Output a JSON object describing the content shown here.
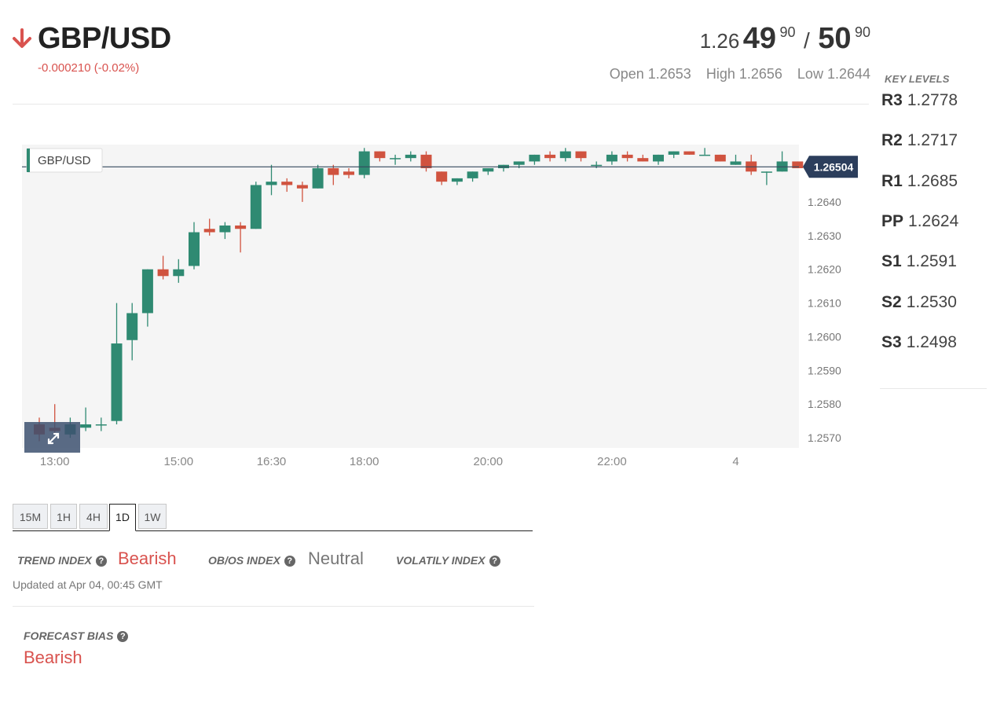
{
  "header": {
    "pair": "GBP/USD",
    "direction_icon": "arrow-down-icon",
    "change": "-0.000210 (-0.02%)",
    "quote": {
      "bid_prefix": "1.26",
      "bid_big": "49",
      "bid_sup": "90",
      "separator": "/",
      "ask_big": "50",
      "ask_sup": "90"
    },
    "open": "Open 1.2653",
    "high": "High 1.2656",
    "low": "Low 1.2644"
  },
  "key_levels": {
    "title": "KEY LEVELS",
    "levels": [
      {
        "name": "R3",
        "value": "1.2778"
      },
      {
        "name": "R2",
        "value": "1.2717"
      },
      {
        "name": "R1",
        "value": "1.2685"
      },
      {
        "name": "PP",
        "value": "1.2624"
      },
      {
        "name": "S1",
        "value": "1.2591"
      },
      {
        "name": "S2",
        "value": "1.2530"
      },
      {
        "name": "S3",
        "value": "1.2498"
      }
    ]
  },
  "chart_data": {
    "type": "candlestick",
    "legend": "GBP/USD",
    "current_price": 1.26504,
    "current_price_label": "1.26504",
    "ylim": [
      1.2567,
      1.2657
    ],
    "y_ticks": [
      "1.2640",
      "1.2630",
      "1.2620",
      "1.2610",
      "1.2600",
      "1.2590",
      "1.2580",
      "1.2570"
    ],
    "y_tick_values": [
      1.264,
      1.263,
      1.262,
      1.261,
      1.26,
      1.259,
      1.258,
      1.257
    ],
    "x_ticks": [
      {
        "label": "13:00",
        "index": 1
      },
      {
        "label": "15:00",
        "index": 9
      },
      {
        "label": "16:30",
        "index": 15
      },
      {
        "label": "18:00",
        "index": 21
      },
      {
        "label": "20:00",
        "index": 29
      },
      {
        "label": "22:00",
        "index": 37
      },
      {
        "label": "4",
        "index": 45
      }
    ],
    "candles": [
      {
        "o": 1.2574,
        "h": 1.2576,
        "l": 1.2569,
        "c": 1.2571
      },
      {
        "o": 1.2573,
        "h": 1.258,
        "l": 1.2571,
        "c": 1.2572
      },
      {
        "o": 1.2571,
        "h": 1.2576,
        "l": 1.257,
        "c": 1.2574
      },
      {
        "o": 1.2573,
        "h": 1.2579,
        "l": 1.2572,
        "c": 1.2574
      },
      {
        "o": 1.2574,
        "h": 1.2576,
        "l": 1.2572,
        "c": 1.2574
      },
      {
        "o": 1.2575,
        "h": 1.261,
        "l": 1.2574,
        "c": 1.2598
      },
      {
        "o": 1.2599,
        "h": 1.261,
        "l": 1.2593,
        "c": 1.2607
      },
      {
        "o": 1.2607,
        "h": 1.262,
        "l": 1.2603,
        "c": 1.262
      },
      {
        "o": 1.262,
        "h": 1.2624,
        "l": 1.2617,
        "c": 1.2618
      },
      {
        "o": 1.2618,
        "h": 1.2623,
        "l": 1.2616,
        "c": 1.262
      },
      {
        "o": 1.2621,
        "h": 1.2634,
        "l": 1.262,
        "c": 1.2631
      },
      {
        "o": 1.2632,
        "h": 1.2635,
        "l": 1.263,
        "c": 1.2631
      },
      {
        "o": 1.2631,
        "h": 1.2634,
        "l": 1.2629,
        "c": 1.2633
      },
      {
        "o": 1.2633,
        "h": 1.2634,
        "l": 1.2625,
        "c": 1.2632
      },
      {
        "o": 1.2632,
        "h": 1.2646,
        "l": 1.2632,
        "c": 1.2645
      },
      {
        "o": 1.2645,
        "h": 1.2651,
        "l": 1.2642,
        "c": 1.2646
      },
      {
        "o": 1.2646,
        "h": 1.2647,
        "l": 1.2643,
        "c": 1.2645
      },
      {
        "o": 1.2645,
        "h": 1.2646,
        "l": 1.264,
        "c": 1.2644
      },
      {
        "o": 1.2644,
        "h": 1.2651,
        "l": 1.2644,
        "c": 1.265
      },
      {
        "o": 1.265,
        "h": 1.2651,
        "l": 1.2645,
        "c": 1.2648
      },
      {
        "o": 1.2649,
        "h": 1.265,
        "l": 1.2647,
        "c": 1.2648
      },
      {
        "o": 1.2648,
        "h": 1.2656,
        "l": 1.2647,
        "c": 1.2655
      },
      {
        "o": 1.2655,
        "h": 1.2655,
        "l": 1.2652,
        "c": 1.2653
      },
      {
        "o": 1.2653,
        "h": 1.2654,
        "l": 1.2651,
        "c": 1.2653
      },
      {
        "o": 1.2653,
        "h": 1.2655,
        "l": 1.2652,
        "c": 1.2654
      },
      {
        "o": 1.2654,
        "h": 1.2655,
        "l": 1.2649,
        "c": 1.265
      },
      {
        "o": 1.2649,
        "h": 1.2649,
        "l": 1.2645,
        "c": 1.2646
      },
      {
        "o": 1.2646,
        "h": 1.2647,
        "l": 1.2645,
        "c": 1.2647
      },
      {
        "o": 1.2647,
        "h": 1.2649,
        "l": 1.2646,
        "c": 1.2649
      },
      {
        "o": 1.2649,
        "h": 1.265,
        "l": 1.2648,
        "c": 1.265
      },
      {
        "o": 1.265,
        "h": 1.2651,
        "l": 1.2649,
        "c": 1.2651
      },
      {
        "o": 1.2651,
        "h": 1.2652,
        "l": 1.265,
        "c": 1.2652
      },
      {
        "o": 1.2652,
        "h": 1.2654,
        "l": 1.2651,
        "c": 1.2654
      },
      {
        "o": 1.2654,
        "h": 1.2655,
        "l": 1.2652,
        "c": 1.2653
      },
      {
        "o": 1.2653,
        "h": 1.2656,
        "l": 1.2652,
        "c": 1.2655
      },
      {
        "o": 1.2655,
        "h": 1.2655,
        "l": 1.2652,
        "c": 1.2653
      },
      {
        "o": 1.2651,
        "h": 1.2652,
        "l": 1.265,
        "c": 1.2651
      },
      {
        "o": 1.2652,
        "h": 1.2655,
        "l": 1.2651,
        "c": 1.2654
      },
      {
        "o": 1.2654,
        "h": 1.2655,
        "l": 1.2652,
        "c": 1.2653
      },
      {
        "o": 1.2653,
        "h": 1.2654,
        "l": 1.2652,
        "c": 1.2652
      },
      {
        "o": 1.2652,
        "h": 1.2654,
        "l": 1.2651,
        "c": 1.2654
      },
      {
        "o": 1.2654,
        "h": 1.2655,
        "l": 1.2653,
        "c": 1.2655
      },
      {
        "o": 1.2655,
        "h": 1.2655,
        "l": 1.2654,
        "c": 1.2654
      },
      {
        "o": 1.2654,
        "h": 1.2656,
        "l": 1.2654,
        "c": 1.2654
      },
      {
        "o": 1.2654,
        "h": 1.2654,
        "l": 1.2652,
        "c": 1.2652
      },
      {
        "o": 1.2651,
        "h": 1.2654,
        "l": 1.2651,
        "c": 1.2652
      },
      {
        "o": 1.2652,
        "h": 1.2654,
        "l": 1.2648,
        "c": 1.2649
      },
      {
        "o": 1.2649,
        "h": 1.2649,
        "l": 1.2645,
        "c": 1.2649
      },
      {
        "o": 1.2649,
        "h": 1.2655,
        "l": 1.2649,
        "c": 1.2652
      },
      {
        "o": 1.2652,
        "h": 1.2652,
        "l": 1.265,
        "c": 1.265
      }
    ],
    "colors": {
      "up": "#2f8a72",
      "down": "#d0533f",
      "bg": "#f5f5f5",
      "price_line": "#34495e",
      "price_tag": "#2c3e5c"
    }
  },
  "timeframes": {
    "buttons": [
      "15M",
      "1H",
      "4H",
      "1D",
      "1W"
    ],
    "active": "1D"
  },
  "indexes": {
    "trend_label": "TREND INDEX",
    "trend_value": "Bearish",
    "obos_label": "OB/OS INDEX",
    "obos_value": "Neutral",
    "volatility_label": "VOLATILY INDEX",
    "help_icon": "question-circle-icon",
    "updated": "Updated at Apr 04, 00:45 GMT"
  },
  "forecast": {
    "label": "FORECAST BIAS",
    "value": "Bearish"
  }
}
